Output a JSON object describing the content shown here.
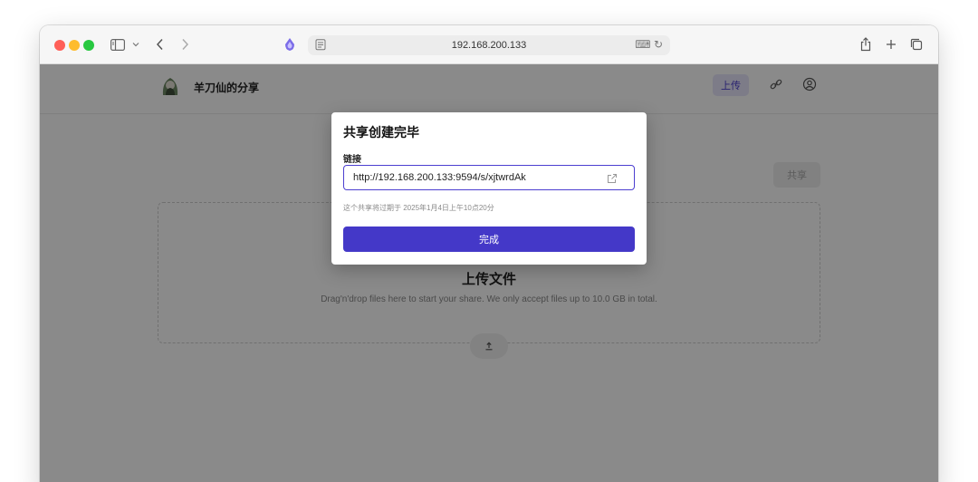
{
  "browser": {
    "address": "192.168.200.133",
    "icons": [
      "sidebar-icon",
      "chevron-down-icon",
      "back-icon",
      "forward-icon",
      "extension-icon",
      "page-icon",
      "translate-icon",
      "reload-icon",
      "share-icon",
      "new-tab-icon",
      "tabs-overview-icon"
    ]
  },
  "app": {
    "site_name": "羊刀仙的分享",
    "nav_upload_label": "上传",
    "share_button_label": "共享",
    "upload_title": "上传文件",
    "upload_description": "Drag'n'drop files here to start your share. We only accept files up to 10.0 GB in total.",
    "accent_color": "#4438c8"
  },
  "modal": {
    "title": "共享创建完毕",
    "link_label": "链接",
    "link_value": "http://192.168.200.133:9594/s/xjtwrdAk",
    "expire_text": "这个共享将过期于 2025年1月4日上午10点20分",
    "done_label": "完成"
  }
}
